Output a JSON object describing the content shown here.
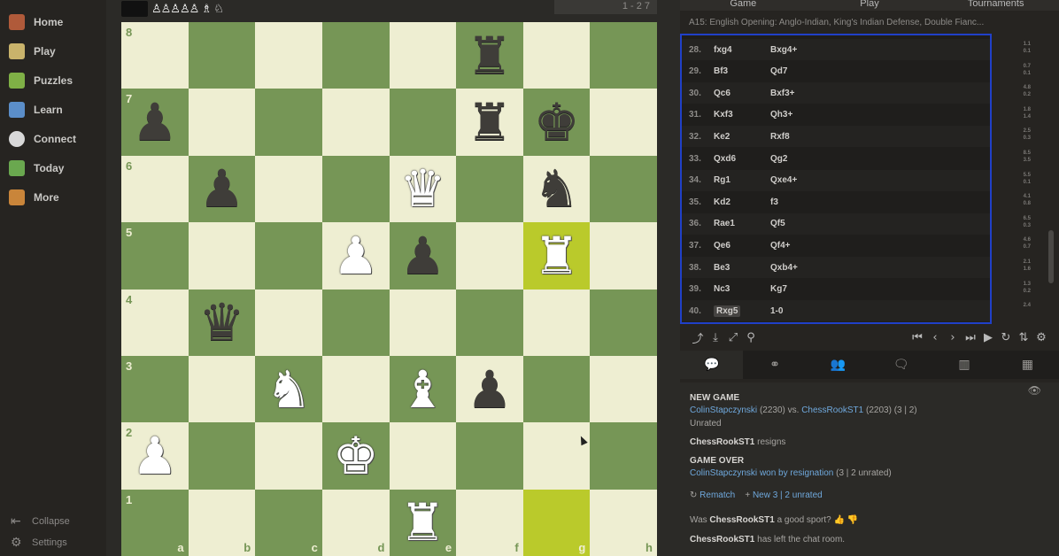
{
  "sidebar": {
    "items": [
      {
        "label": "Home",
        "icon": "home-icon",
        "color": "#b05a3a"
      },
      {
        "label": "Play",
        "icon": "pawn-play-icon",
        "color": "#c9b36b"
      },
      {
        "label": "Puzzles",
        "icon": "puzzle-icon",
        "color": "#7fb046"
      },
      {
        "label": "Learn",
        "icon": "learn-icon",
        "color": "#5b8ec9"
      },
      {
        "label": "Connect",
        "icon": "chat-bubble-icon",
        "color": "#d8d8d8"
      },
      {
        "label": "Today",
        "icon": "monitor-icon",
        "color": "#6aa84f"
      },
      {
        "label": "More",
        "icon": "grid-more-icon",
        "color": "#c9853a"
      }
    ],
    "collapse": "Collapse",
    "settings": "Settings"
  },
  "top": {
    "captured": "♙♙♙♙♙ ♗ ♘",
    "clock": "1 - 2 7"
  },
  "board": {
    "files": [
      "a",
      "b",
      "c",
      "d",
      "e",
      "f",
      "g",
      "h"
    ],
    "ranks": [
      "8",
      "7",
      "6",
      "5",
      "4",
      "3",
      "2",
      "1"
    ],
    "highlighted": [
      "g5",
      "g1"
    ],
    "pieces": {
      "f8": "bR",
      "a7": "bP",
      "f7": "bR",
      "g7": "bK",
      "b6": "bP",
      "e6": "wQ",
      "g6": "bN",
      "d5": "wP",
      "e5": "bP",
      "g5": "wR",
      "b4": "bQ",
      "c3": "wN",
      "e3": "wB",
      "f3": "bP",
      "a2": "wP",
      "d2": "wK",
      "e1": "wR"
    }
  },
  "panel": {
    "tabs": [
      "Game",
      "Play",
      "Tournaments"
    ],
    "opening": "A15: English Opening: Anglo-Indian, King's Indian Defense, Double Fianc...",
    "moves": [
      {
        "n": "28.",
        "w": "fxg4",
        "b": "Bxg4+",
        "t1": "1.1",
        "t2": "0.1"
      },
      {
        "n": "29.",
        "w": "Bf3",
        "b": "Qd7",
        "t1": "0.7",
        "t2": "0.1"
      },
      {
        "n": "30.",
        "w": "Qc6",
        "b": "Bxf3+",
        "t1": "4.8",
        "t2": "0.2"
      },
      {
        "n": "31.",
        "w": "Kxf3",
        "b": "Qh3+",
        "t1": "1.8",
        "t2": "1.4"
      },
      {
        "n": "32.",
        "w": "Ke2",
        "b": "Rxf8",
        "t1": "2.5",
        "t2": "0.3"
      },
      {
        "n": "33.",
        "w": "Qxd6",
        "b": "Qg2",
        "t1": "8.5",
        "t2": "3.5"
      },
      {
        "n": "34.",
        "w": "Rg1",
        "b": "Qxe4+",
        "t1": "5.5",
        "t2": "0.1"
      },
      {
        "n": "35.",
        "w": "Kd2",
        "b": "f3",
        "t1": "4.1",
        "t2": "0.8"
      },
      {
        "n": "36.",
        "w": "Rae1",
        "b": "Qf5",
        "t1": "6.5",
        "t2": "0.3"
      },
      {
        "n": "37.",
        "w": "Qe6",
        "b": "Qf4+",
        "t1": "4.6",
        "t2": "0.7"
      },
      {
        "n": "38.",
        "w": "Be3",
        "b": "Qxb4+",
        "t1": "2.1",
        "t2": "1.6"
      },
      {
        "n": "39.",
        "w": "Nc3",
        "b": "Kg7",
        "t1": "1.3",
        "t2": "0.2"
      },
      {
        "n": "40.",
        "w": "Rxg5",
        "b": "1-0",
        "t1": "2.4",
        "t2": ""
      }
    ]
  },
  "chat": {
    "new_game": "NEW GAME",
    "player1": "ColinStapczynski",
    "rating1": "(2230)",
    "vs": "vs.",
    "player2": "ChessRookST1",
    "rating2": "(2203)",
    "time": "(3 | 2)",
    "unrated": "Unrated",
    "resign_name": "ChessRookST1",
    "resign_text": "resigns",
    "game_over": "GAME OVER",
    "winner": "ColinStapczynski",
    "won_text": "won by resignation",
    "won_meta": "(3 | 2 unrated)",
    "rematch": "Rematch",
    "new_label": "New 3 | 2 unrated",
    "sport_pre": "Was",
    "sport_name": "ChessRookST1",
    "sport_post": "a good sport?",
    "left_name": "ChessRookST1",
    "left_text": "has left the chat room."
  },
  "colors": {
    "light": "#eeeed2",
    "dark": "#769656",
    "hl_dark": "#baca2b",
    "hl_light": "#f6f669",
    "accent": "#2040c8"
  }
}
